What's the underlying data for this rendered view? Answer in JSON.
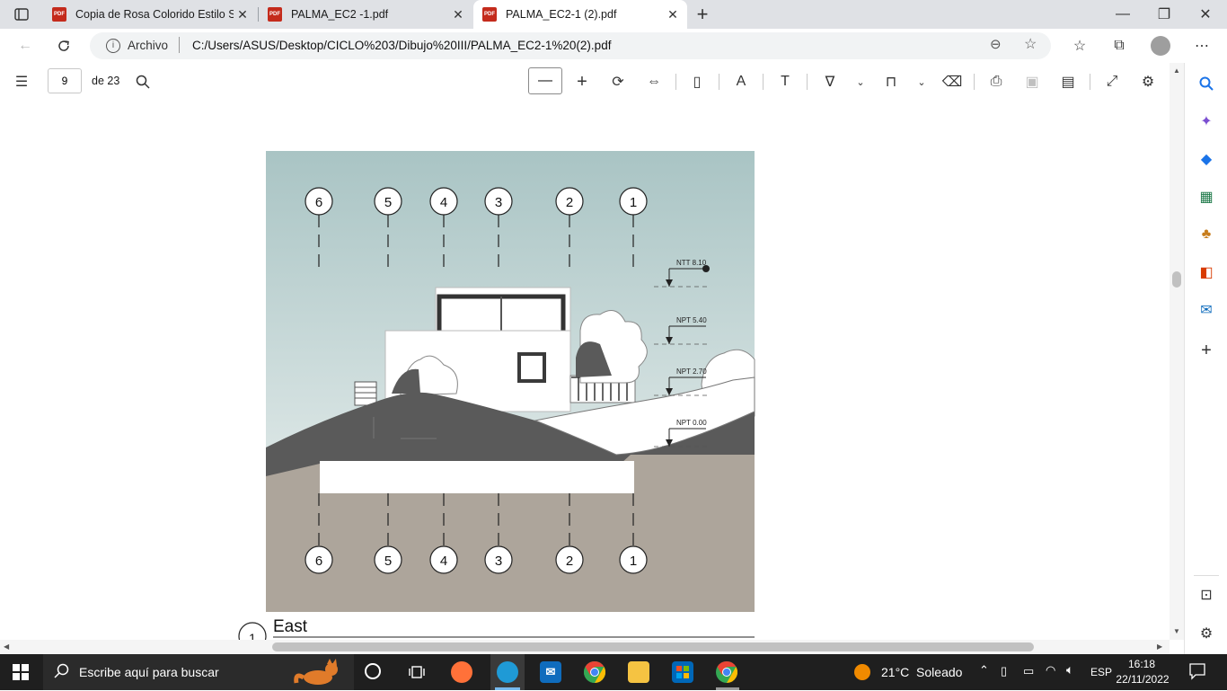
{
  "tabs": [
    {
      "title": "Copia de Rosa Colorido Estilo Se",
      "active": false
    },
    {
      "title": "PALMA_EC2 -1.pdf",
      "active": false
    },
    {
      "title": "PALMA_EC2-1 (2).pdf",
      "active": true
    }
  ],
  "tab_icon_label": "PDF",
  "new_tab_glyph": "+",
  "window_controls": {
    "minimize": "—",
    "maximize": "❐",
    "close": "✕"
  },
  "address": {
    "site_label": "Archivo",
    "url": "C:/Users/ASUS/Desktop/CICLO%203/Dibujo%20III/PALMA_EC2-1%20(2).pdf"
  },
  "pdf_toolbar": {
    "page_number": "9",
    "page_total": "de 23"
  },
  "drawing": {
    "grid_labels_top": [
      "6",
      "5",
      "4",
      "3",
      "2",
      "1"
    ],
    "grid_labels_bottom": [
      "6",
      "5",
      "4",
      "3",
      "2",
      "1"
    ],
    "level_labels": [
      "NTT 8.10",
      "NPT 5.40",
      "NPT 2.70",
      "NPT 0.00"
    ],
    "view_number": "1",
    "view_title": "East"
  },
  "taskbar": {
    "search_placeholder": "Escribe aquí para buscar",
    "weather": "21°C  Soleado",
    "language": "ESP",
    "time": "16:18",
    "date": "22/11/2022"
  },
  "colors": {
    "sky_top": "#a9c4c4",
    "sky_bottom": "#f3f6f5",
    "ground": "#ada59b",
    "terrain": "#5a5a5a",
    "tab_strip": "#dfe1e5",
    "taskbar": "#1f1f1f",
    "pdf_red": "#c42b1c"
  }
}
